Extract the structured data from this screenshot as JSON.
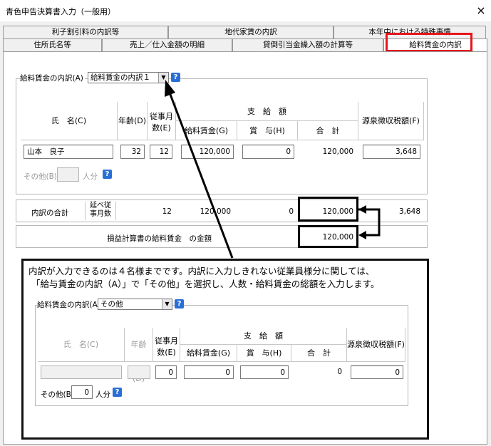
{
  "window": {
    "title": "青色申告決算書入力（一般用）",
    "close_glyph": "×"
  },
  "tabs_back": [
    "利子割引料の内訳等",
    "地代家賃の内訳",
    "本年中における特殊事情"
  ],
  "tabs_front": [
    "住所氏名等",
    "売上／仕入金額の明細",
    "貸倒引当金繰入額の計算等",
    "給料賃金の内訳"
  ],
  "form": {
    "breakdown_label": "給料賃金の内訳(A)",
    "breakdown_value": "給料賃金の内訳１",
    "help": "?",
    "headers": {
      "name": "氏　名(C)",
      "age": "年齢(D)",
      "months_l1": "従事月",
      "months_l2": "数(E)",
      "payment": "支　給　額",
      "salary": "給料賃金(G)",
      "bonus": "賞　与(H)",
      "total": "合　計",
      "withholding": "源泉徴収税額(F)"
    },
    "row": {
      "name": "山本　良子",
      "age": "32",
      "months": "12",
      "salary": "120,000",
      "bonus": "0",
      "total": "120,000",
      "withholding": "3,648"
    },
    "others_label": "その他(B)",
    "people_unit": "人分",
    "sum": {
      "label": "内訳の合計",
      "months_label_l1": "延べ従",
      "months_label_l2": "事月数",
      "months": "12",
      "salary": "120,000",
      "bonus": "0",
      "total": "120,000",
      "withholding": "3,648"
    },
    "pl": {
      "label": "損益計算書の給料賃金　の金額",
      "total": "120,000"
    }
  },
  "callout": {
    "line1": "内訳が入力できるのは４名様までです。内訳に入力しきれない従業員様分に関しては、",
    "line2": "「給与賃金の内訳（A）」で「その他」を選択し、人数・給料賃金の総額を入力します。"
  },
  "inset": {
    "breakdown_label": "給料賃金の内訳(A)",
    "breakdown_value": "その他",
    "headers": {
      "name": "氏　名(C)",
      "age": "年齢(D)",
      "months_l1": "従事月",
      "months_l2": "数(E)",
      "payment": "支　給　額",
      "salary": "給料賃金(G)",
      "bonus": "賞　与(H)",
      "total": "合　計",
      "withholding": "源泉徴収税額(F)"
    },
    "row": {
      "months": "0",
      "salary": "0",
      "bonus": "0",
      "total": "0",
      "withholding": "0"
    },
    "others_label": "その他(B)",
    "others_value": "0",
    "people_unit": "人分"
  }
}
